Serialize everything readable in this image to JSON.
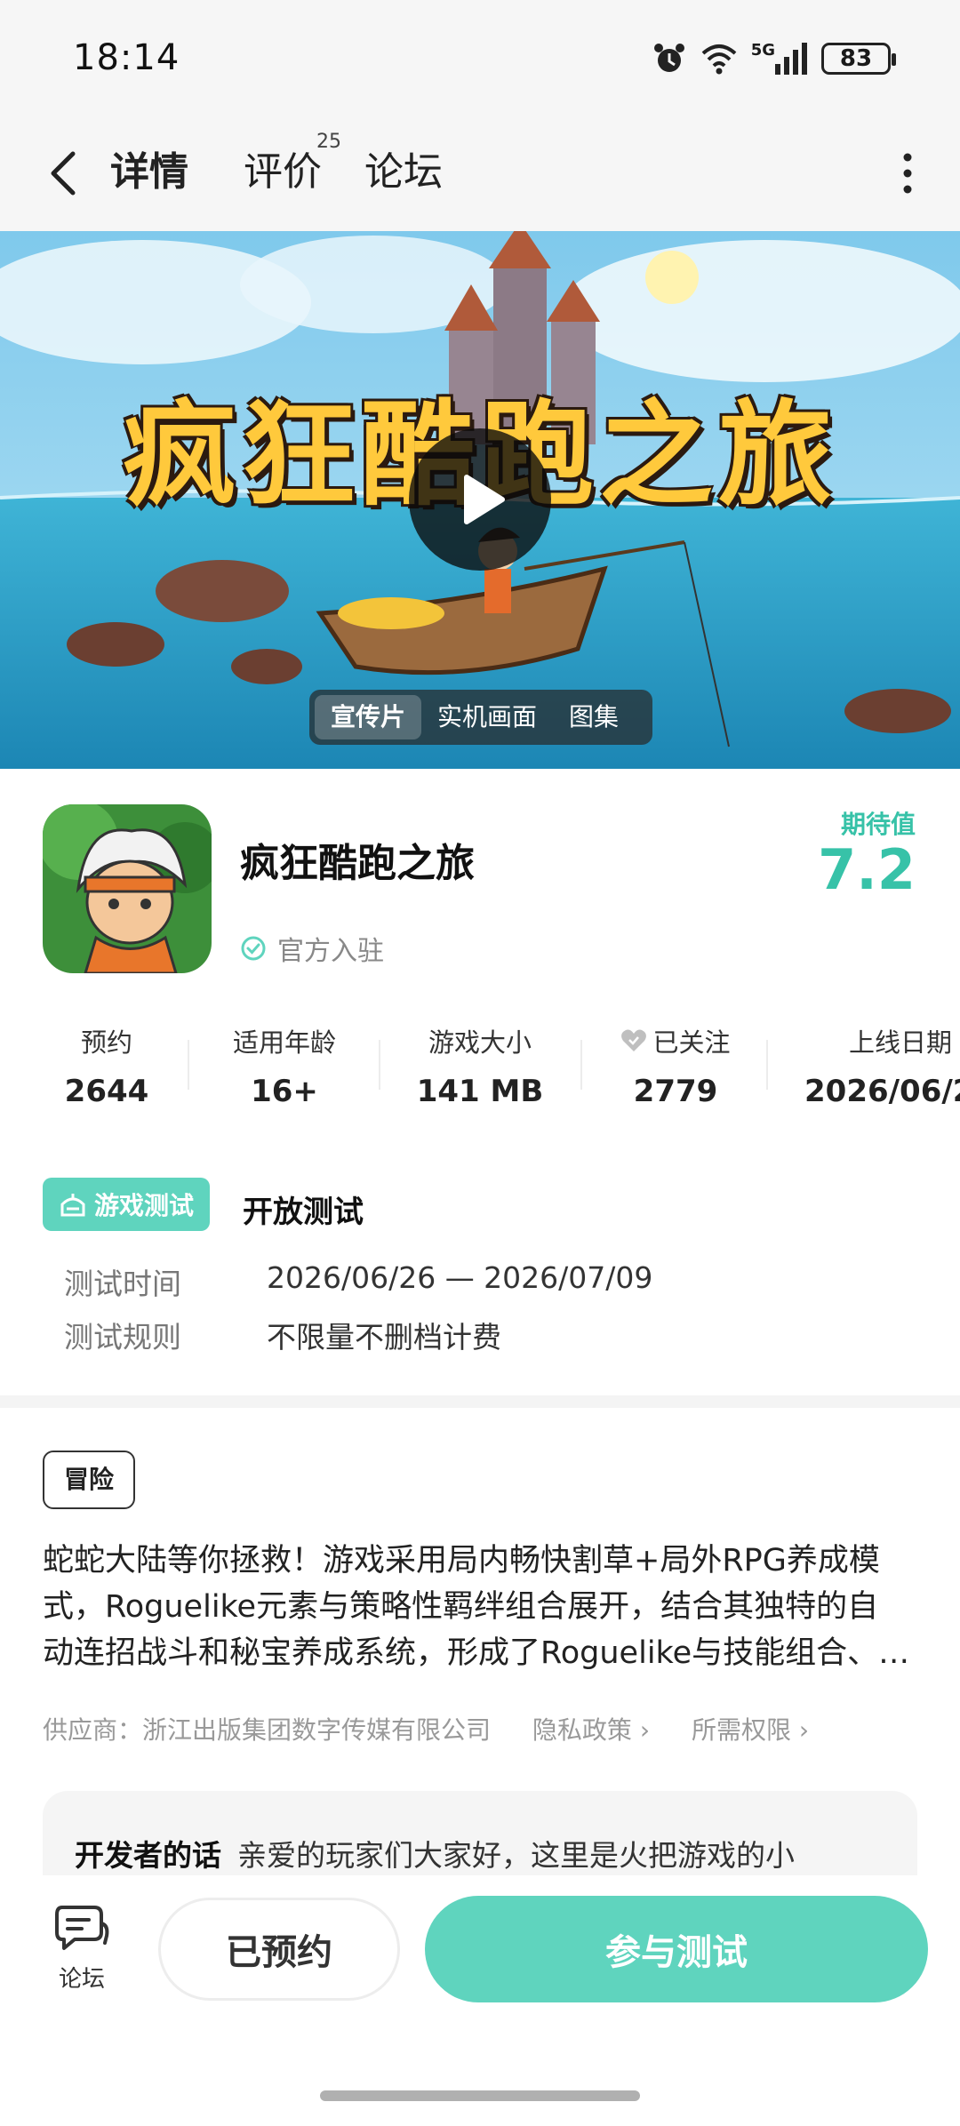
{
  "status_bar": {
    "time": "18:14",
    "network": "5G",
    "battery": "83"
  },
  "nav": {
    "tabs": [
      {
        "label": "详情",
        "active": true
      },
      {
        "label": "评价",
        "badge": "25"
      },
      {
        "label": "论坛"
      }
    ]
  },
  "hero": {
    "title": "疯狂酷跑之旅",
    "media_tabs": [
      "宣传片",
      "实机画面",
      "图集"
    ],
    "active_media_tab": "宣传片"
  },
  "app": {
    "name": "疯狂酷跑之旅",
    "official_label": "官方入驻",
    "expectation_label": "期待值",
    "expectation_value": "7.2"
  },
  "stats": [
    {
      "label": "预约",
      "value": "2644"
    },
    {
      "label": "适用年龄",
      "value": "16+"
    },
    {
      "label": "游戏大小",
      "value": "141 MB"
    },
    {
      "label": "已关注",
      "value": "2779",
      "icon": "heart-icon"
    },
    {
      "label": "上线日期",
      "value": "2026/06/2"
    }
  ],
  "test": {
    "badge": "游戏测试",
    "title": "开放测试",
    "rows": [
      {
        "label": "测试时间",
        "value": "2026/06/26 — 2026/07/09"
      },
      {
        "label": "测试规则",
        "value": "不限量不删档计费"
      }
    ]
  },
  "genre": "冒险",
  "description": {
    "line1": "蛇蛇大陆等你拯救！游戏采用局内畅快割草+局外RPG养成模",
    "line2": "式，Roguelike元素与策略性羁绊组合展开，结合其独特的自",
    "line3": "动连招战斗和秘宝养成系统，形成了Roguelike与技能组合、…"
  },
  "provider": {
    "label": "供应商：浙江出版集团数字传媒有限公司",
    "privacy": "隐私政策",
    "permissions": "所需权限"
  },
  "developer": {
    "title": "开发者的话",
    "text": "亲爱的玩家们大家好，这里是火把游戏的小"
  },
  "bottom": {
    "forum": "论坛",
    "reserved": "已预约",
    "join": "参与测试"
  },
  "colors": {
    "accent": "#5fd4be",
    "score": "#37c2a8"
  }
}
